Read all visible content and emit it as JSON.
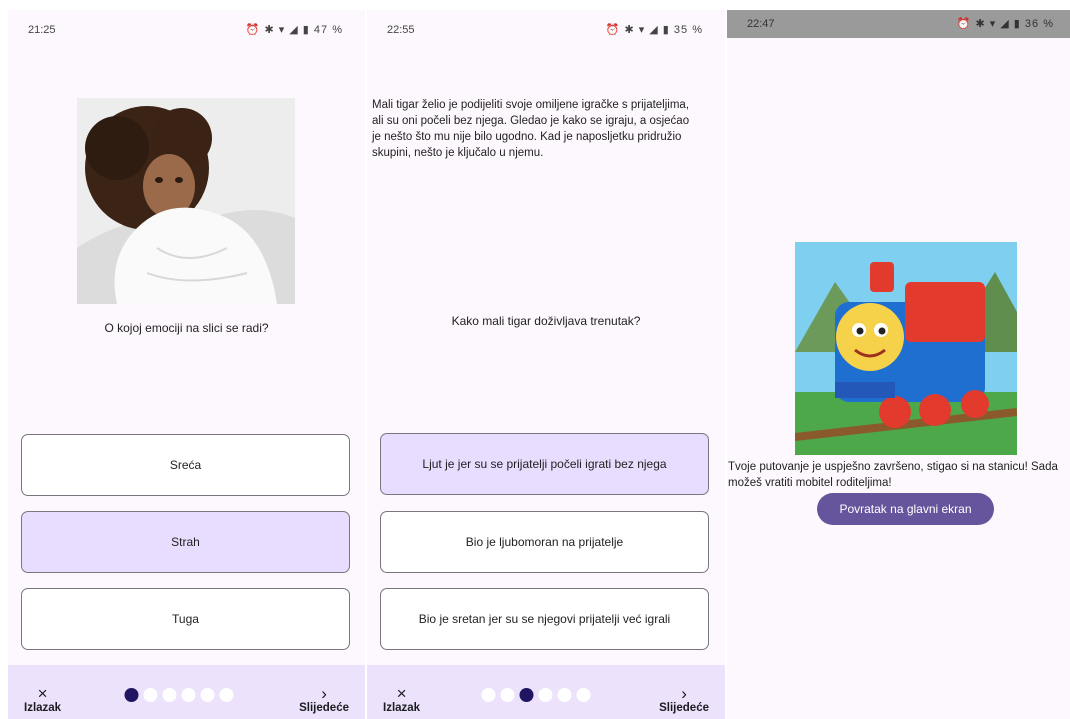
{
  "screen1": {
    "status": {
      "time": "21:25",
      "icons": "⏰ ✱ ▾ ◢ ▮ 47 %"
    },
    "question": "O kojoj emociji na slici se radi?",
    "answers": [
      "Sreća",
      "Strah",
      "Tuga"
    ],
    "selected_answer": "Strah",
    "nav": {
      "exit_label": "Izlazak",
      "next_label": "Slijedeće",
      "progress_step": 1,
      "progress_total": 6
    }
  },
  "screen2": {
    "status": {
      "time": "22:55",
      "icons": "⏰ ✱ ▾ ◢ ▮ 35 %"
    },
    "story": "Mali tigar želio je podijeliti svoje omiljene igračke s prijateljima, ali su oni počeli bez njega. Gledao je kako se igraju, a osjećao je nešto što mu nije bilo ugodno. Kad je naposljetku pridružio skupini, nešto je ključalo u njemu.",
    "question": "Kako mali tigar doživljava trenutak?",
    "answers": [
      "Ljut je jer su se prijatelji počeli igrati bez njega",
      "Bio je ljubomoran na prijatelje",
      "Bio je sretan jer su se njegovi prijatelji već igrali"
    ],
    "selected_answer": "Ljut je jer su se prijatelji počeli igrati bez njega",
    "nav": {
      "exit_label": "Izlazak",
      "next_label": "Slijedeće",
      "progress_step": 3,
      "progress_total": 6
    }
  },
  "screen3": {
    "status": {
      "time": "22:47",
      "icons": "⏰ ✱ ▾ ◢ ▮ 36 %"
    },
    "message": "Tvoje putovanje je uspješno završeno, stigao si na stanicu! Sada možeš vratiti mobitel roditeljima!",
    "home_button": "Povratak na glavni ekran"
  },
  "icons": {
    "exit": "×",
    "next": "›"
  },
  "colors": {
    "selected": "#e9ddff",
    "nav_bar": "#ece2fb",
    "dot_active": "#1f1563",
    "button": "#66559d"
  }
}
